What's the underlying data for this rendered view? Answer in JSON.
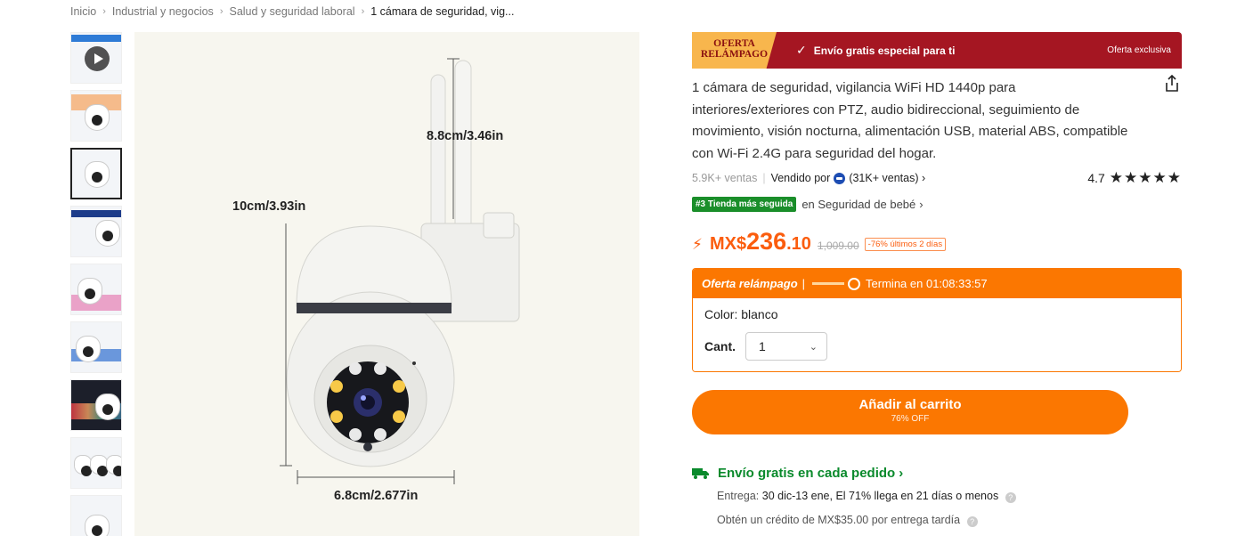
{
  "breadcrumb": {
    "items": [
      "Inicio",
      "Industrial y negocios",
      "Salud y seguridad laboral"
    ],
    "current": "1 cámara de seguridad, vig..."
  },
  "gallery": {
    "thumbnail_count": 9,
    "active_index": 2,
    "dimensions": {
      "antenna": "8.8cm/3.46in",
      "height": "10cm/3.93in",
      "width": "6.8cm/2.677in"
    }
  },
  "banner": {
    "flash_label_line1": "OFERTA",
    "flash_label_line2": "RELÁMPAGO",
    "free_shipping": "Envío gratis especial para ti",
    "exclusive": "Oferta exclusiva"
  },
  "product": {
    "title": "1 cámara de seguridad, vigilancia WiFi HD 1440p para interiores/exteriores con PTZ, audio bidireccional, seguimiento de movimiento, visión nocturna, alimentación USB, material ABS, compatible con Wi-Fi 2.4G para seguridad del hogar.",
    "sales": "5.9K+ ventas",
    "sold_by": "Vendido por",
    "seller_sales": "(31K+ ventas)",
    "rating": "4.7",
    "stars": "★★★★★",
    "store_badge": "#3 Tienda más seguida",
    "store_category": "en Seguridad de bebé"
  },
  "price": {
    "currency": "MX$",
    "integer": "236",
    "decimal": ".10",
    "original": "1,009.00",
    "discount": "-76% últimos 2 días"
  },
  "flash_sale": {
    "label": "Oferta relámpago",
    "ends_label": "Termina en 01:08:33:57",
    "color_label": "Color: blanco",
    "qty_label": "Cant.",
    "qty_value": "1"
  },
  "cart": {
    "label": "Añadir al carrito",
    "sub": "76% OFF"
  },
  "shipping": {
    "title": "Envío gratis en cada pedido",
    "delivery_prefix": "Entrega:",
    "delivery_text": "30 dic-13 ene, El 71% llega en 21 días o menos",
    "credit": "Obtén un crédito de MX$35.00 por entrega tardía"
  },
  "colors": {
    "brand_orange": "#fb7701",
    "banner_red": "#a51622",
    "green": "#0a8a2c",
    "price_orange": "#fb5d0e"
  }
}
